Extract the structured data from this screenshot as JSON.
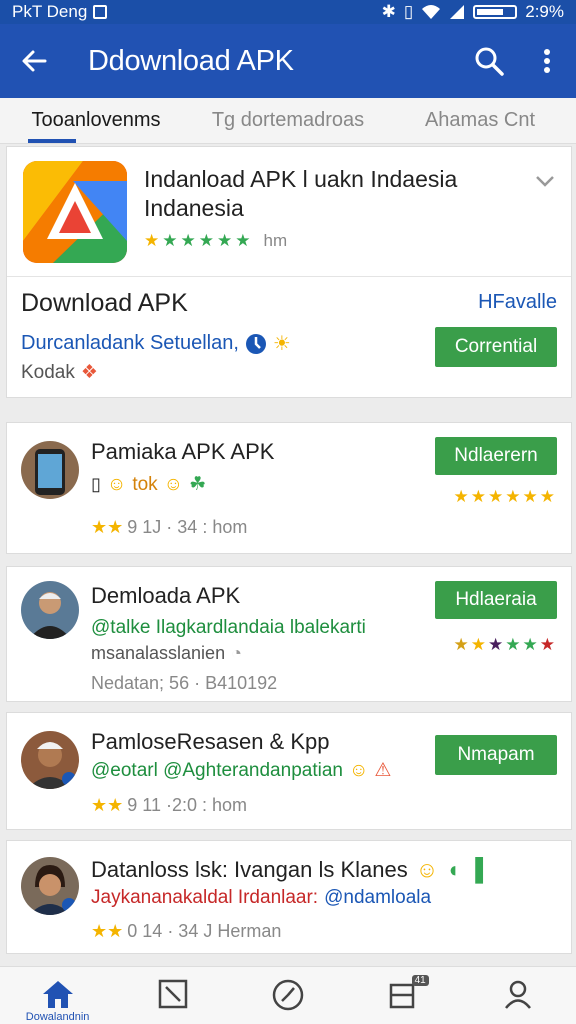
{
  "status_bar": {
    "left_text": "PkT Deng",
    "time": "2:9%"
  },
  "app_bar": {
    "title": "Ddownload APK"
  },
  "tabs": [
    {
      "label": "Tooanlovenms",
      "active": true
    },
    {
      "label": "Tg dortemadroas",
      "active": false
    },
    {
      "label": "Ahamas Cnt",
      "active": false
    }
  ],
  "featured": {
    "title": "Indanload APK l uakn Indaesia Indanesia",
    "rating_meta": "hm",
    "section_title": "Download APK",
    "section_link": "HFavalle",
    "subtitle": "Durcanladank Setuellan,",
    "subtitle2": "Kodak",
    "button_label": "Corrential"
  },
  "list_items": [
    {
      "title": "Pamiaka APK APK",
      "line2": "tok",
      "meta": "9 1J · 34 : hom",
      "button_label": "Ndlaerern"
    },
    {
      "title": "Demloada APK",
      "line2": "@talke Ilagkardlandaia lbalekarti",
      "line3": "msanalasslanien",
      "meta": "Nedatan; 56 · B410192",
      "button_label": "Hdlaeraia"
    },
    {
      "title": "PamloseResasen & Kpp",
      "line2": "@eotarl @Aghterandanpatian",
      "meta": "9 11 ·2:0 : hom",
      "button_label": "Nmapam"
    },
    {
      "title": "Datanloss lsk: Ivangan ls Klanes",
      "line2_red": "Jaykananakaldal Irdanlaar:",
      "line2_blue": "@ndamloala",
      "meta": "0 14 · 34 J Herman"
    }
  ],
  "bottom_nav": [
    {
      "icon": "home-icon",
      "label": "Dowalandnin",
      "active": true
    },
    {
      "icon": "crop-icon",
      "label": "",
      "active": false
    },
    {
      "icon": "compass-icon",
      "label": "",
      "active": false
    },
    {
      "icon": "library-icon",
      "label": "",
      "active": false,
      "badge": "41"
    },
    {
      "icon": "account-icon",
      "label": "",
      "active": false
    }
  ],
  "colors": {
    "primary": "#2152b3",
    "green_button": "#3a9e4a",
    "link_blue": "#1b57b5",
    "star": "#f4b400",
    "red_text": "#c62828",
    "green_text": "#1e8e3e"
  }
}
